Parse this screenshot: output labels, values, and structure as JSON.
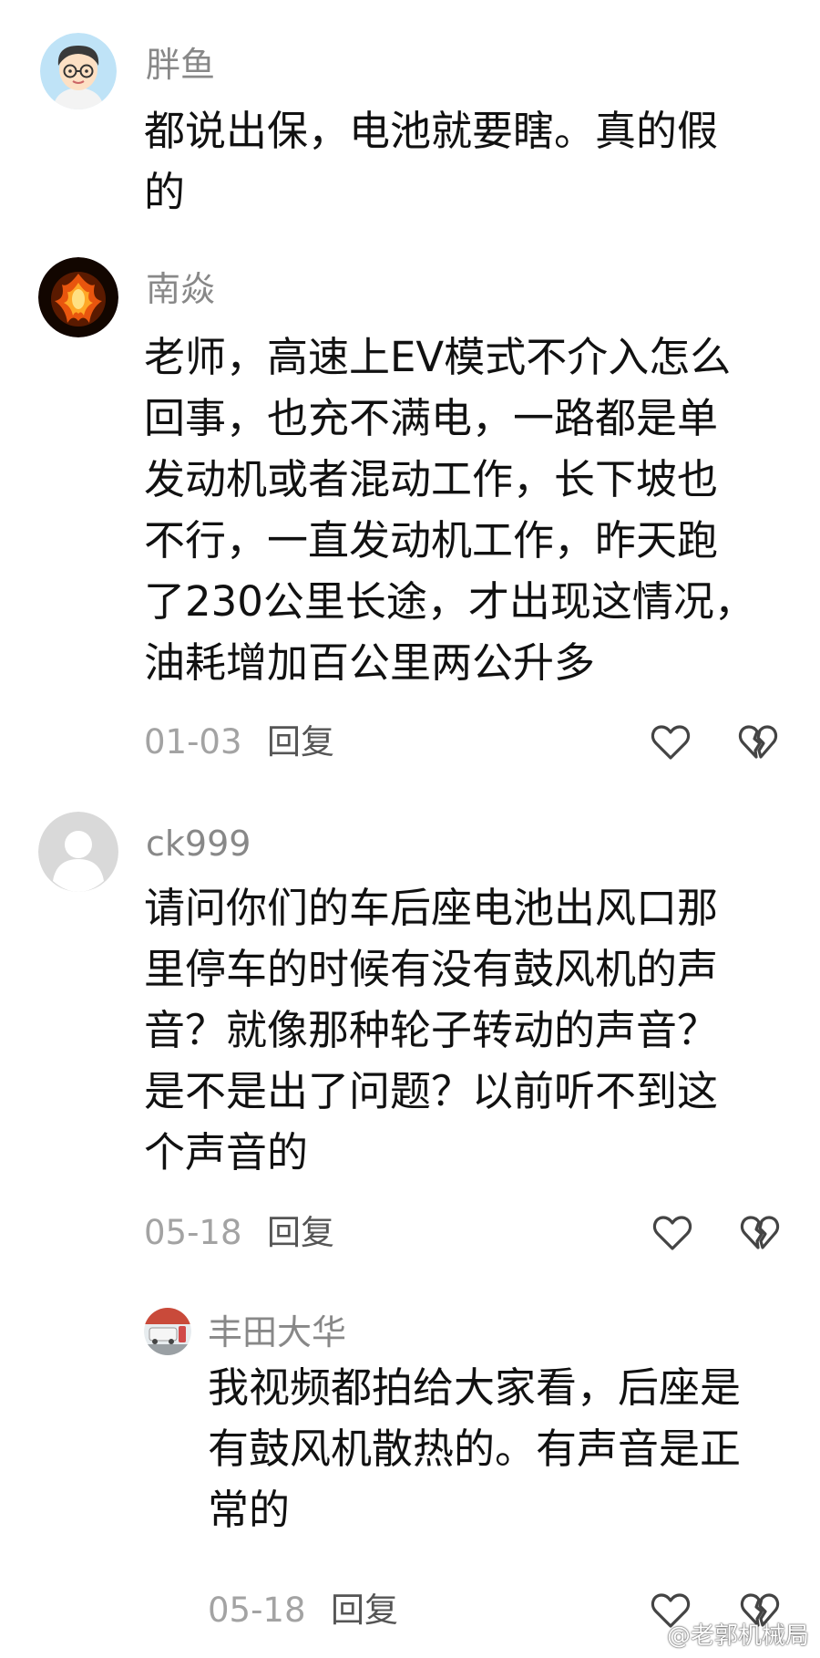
{
  "comments": [
    {
      "username": "胖鱼",
      "lines": [
        "都说出保，电池就要瞎。真的假",
        "的"
      ]
    },
    {
      "username": "南焱",
      "lines": [
        "老师，高速上EV模式不介入怎么",
        "回事，也充不满电，一路都是单",
        "发动机或者混动工作，长下坡也",
        "不行，一直发动机工作，昨天跑",
        "了230公里长途，才出现这情况，",
        "油耗增加百公里两公升多"
      ],
      "date": "01-03",
      "reply_label": "回复"
    },
    {
      "username": "ck999",
      "lines": [
        "请问你们的车后座电池出风口那",
        "里停车的时候有没有鼓风机的声",
        "音？就像那种轮子转动的声音？",
        "是不是出了问题？以前听不到这",
        "个声音的"
      ],
      "date": "05-18",
      "reply_label": "回复"
    },
    {
      "username": "丰田大华",
      "lines": [
        "我视频都拍给大家看，后座是",
        "有鼓风机散热的。有声音是正",
        "常的"
      ],
      "date": "05-18",
      "reply_label": "回复"
    }
  ],
  "icons": {
    "like": "heart-icon",
    "dislike": "broken-heart-icon"
  },
  "watermark": "@老郭机械局",
  "colors": {
    "username": "#888888",
    "date": "#a3a3a3",
    "icon": "#444444"
  }
}
